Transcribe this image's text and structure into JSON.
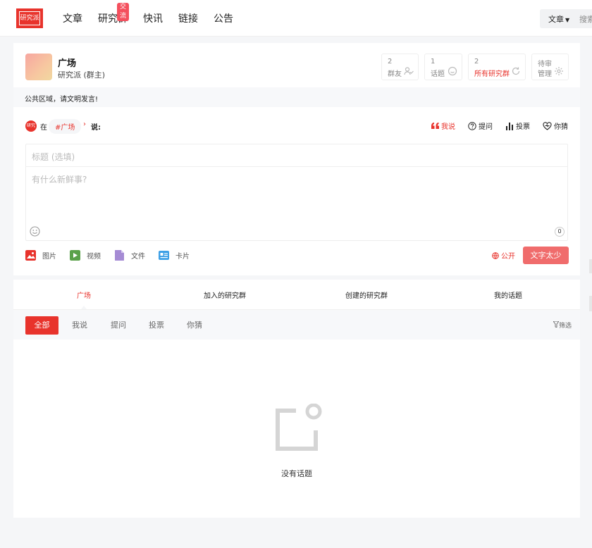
{
  "nav": {
    "logo_text": "研究派",
    "items": [
      {
        "label": "文章"
      },
      {
        "label": "研究群",
        "badge": "交流"
      },
      {
        "label": "快讯"
      },
      {
        "label": "链接"
      },
      {
        "label": "公告"
      }
    ],
    "search_type": "文章",
    "search_placeholder": "搜索"
  },
  "group": {
    "name": "广场",
    "owner": "研究派 (群主)",
    "stats": [
      {
        "num": "2",
        "label": "群友",
        "icon": "users-icon"
      },
      {
        "num": "1",
        "label": "话题",
        "icon": "chat-icon"
      },
      {
        "num": "2",
        "label": "所有研究群",
        "icon": "refresh-icon",
        "red": true
      },
      {
        "num": "待审",
        "label": "管理",
        "icon": "gear-icon"
      }
    ],
    "notice": "公共区域，请文明发言!"
  },
  "composer": {
    "avatar_text": "研究派",
    "zai": "在",
    "tag": "#广场",
    "shuo": "说:",
    "actions": [
      {
        "label": "我说",
        "icon": "quote-icon",
        "active": true
      },
      {
        "label": "提问",
        "icon": "question-icon"
      },
      {
        "label": "投票",
        "icon": "bar-chart-icon"
      },
      {
        "label": "你猜",
        "icon": "heart-icon"
      }
    ],
    "title_placeholder": "标题 (选填)",
    "body_placeholder": "有什么新鲜事?",
    "char_count": "0",
    "media": [
      {
        "label": "图片",
        "icon": "image-icon",
        "color": "#e8332c"
      },
      {
        "label": "视频",
        "icon": "video-icon",
        "color": "#5aa14a"
      },
      {
        "label": "文件",
        "icon": "file-icon",
        "color": "#a58bd4"
      },
      {
        "label": "卡片",
        "icon": "card-icon",
        "color": "#3ea0e6"
      }
    ],
    "visibility": "公开",
    "submit": "文字太少"
  },
  "feed": {
    "tabs": [
      "广场",
      "加入的研究群",
      "创建的研究群",
      "我的话题"
    ],
    "filters": [
      "全部",
      "我说",
      "提问",
      "投票",
      "你猜"
    ],
    "filter_button": "筛选",
    "empty_text": "没有话题"
  },
  "colors": {
    "accent": "#e8332c",
    "submit_bg": "#f06c6c",
    "badge": "#f44f5d"
  }
}
